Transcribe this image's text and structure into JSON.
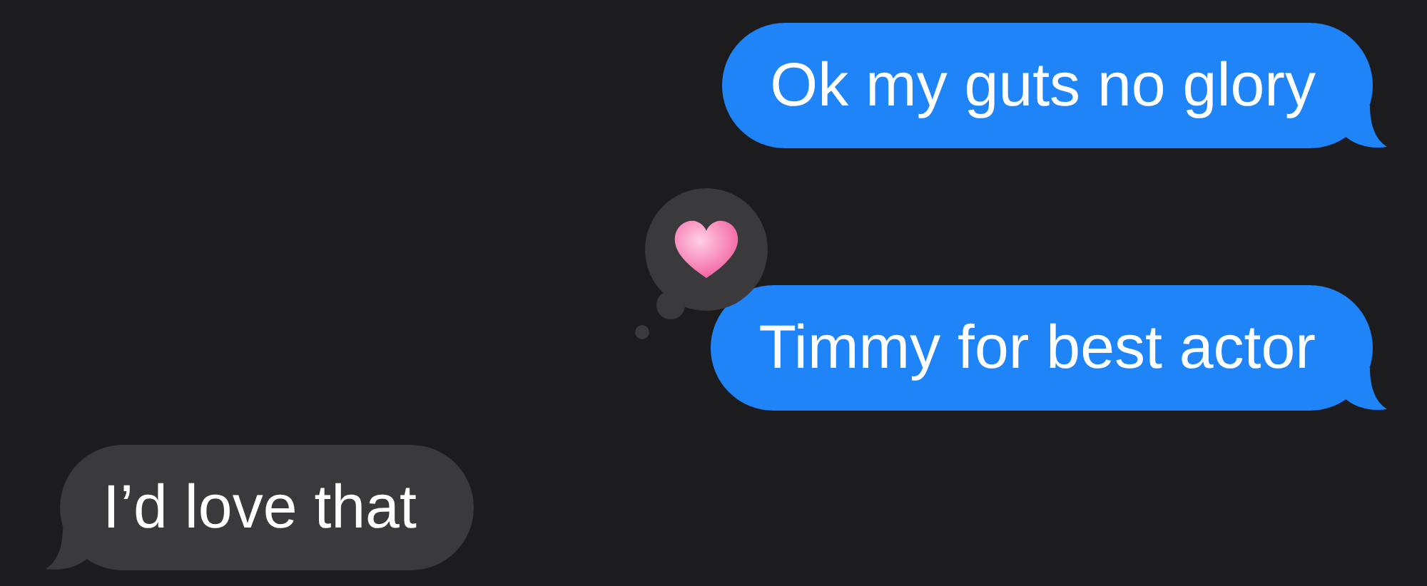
{
  "messages": [
    {
      "text": "Ok my guts no glory",
      "kind": "sent"
    },
    {
      "text": "Timmy for best actor",
      "kind": "sent",
      "reaction": {
        "kind": "heart"
      }
    },
    {
      "text": "I’d love that",
      "kind": "received"
    }
  ]
}
